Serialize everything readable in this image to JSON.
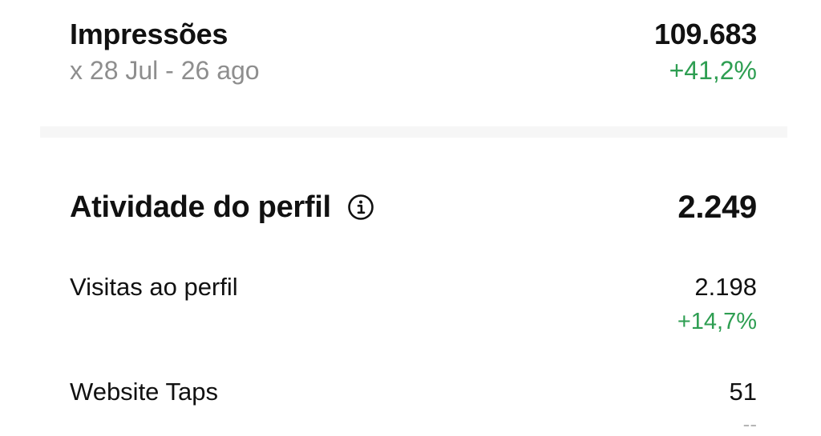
{
  "impressions": {
    "title": "Impressões",
    "date_range": "x 28 Jul - 26 ago",
    "value": "109.683",
    "change": "+41,2%"
  },
  "profile_activity": {
    "title": "Atividade do perfil",
    "info_icon": "info-icon",
    "value": "2.249",
    "metrics": [
      {
        "label": "Visitas ao perfil",
        "value": "2.198",
        "change": "+14,7%"
      },
      {
        "label": "Website Taps",
        "value": "51",
        "change": "--"
      }
    ]
  },
  "colors": {
    "positive": "#2e9e52",
    "muted": "#8e8e8e",
    "divider": "#f6f6f6"
  }
}
